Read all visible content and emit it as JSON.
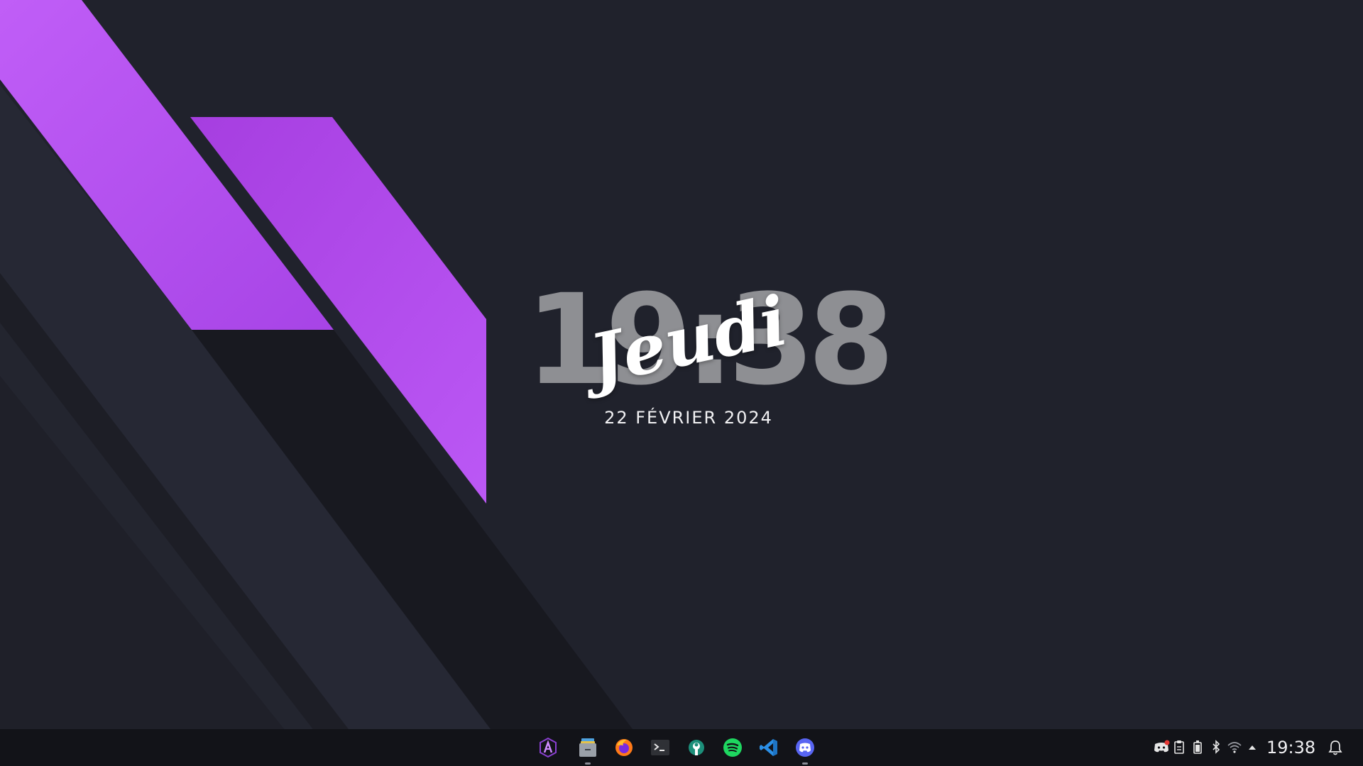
{
  "desktop": {
    "clock_widget": {
      "time": "19:38",
      "day": "Jeudi",
      "date": "22 FÉVRIER 2024"
    }
  },
  "taskbar": {
    "launchers": [
      {
        "name": "arcolinux-launcher",
        "icon": "arcolinux-icon",
        "running": false
      },
      {
        "name": "file-manager",
        "icon": "folder-icon",
        "running": true
      },
      {
        "name": "firefox",
        "icon": "firefox-icon",
        "running": false
      },
      {
        "name": "terminal",
        "icon": "terminal-icon",
        "running": false
      },
      {
        "name": "system-tool",
        "icon": "wrench-icon",
        "running": false
      },
      {
        "name": "spotify",
        "icon": "spotify-icon",
        "running": false
      },
      {
        "name": "vscode",
        "icon": "vscode-icon",
        "running": false
      },
      {
        "name": "discord",
        "icon": "discord-icon",
        "running": true
      }
    ],
    "tray": {
      "icons": [
        "discord-tray-icon",
        "clipboard-icon",
        "battery-icon",
        "bluetooth-icon",
        "wifi-icon",
        "expand-arrow-icon"
      ],
      "clock": "19:38",
      "notifications_icon": "bell-icon"
    }
  },
  "colors": {
    "background": "#20222c",
    "accent_purple": "#b24ff0",
    "taskbar": "#121318"
  }
}
